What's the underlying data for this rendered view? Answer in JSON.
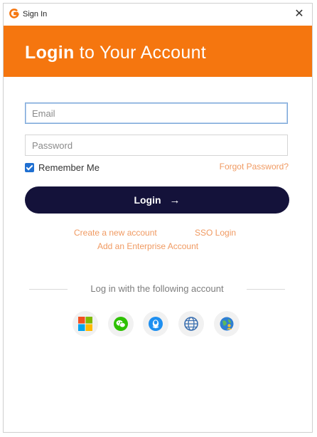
{
  "window": {
    "title": "Sign In",
    "close_glyph": "✕"
  },
  "banner": {
    "title_bold": "Login",
    "title_rest": " to Your Account",
    "color": "#f5760f"
  },
  "form": {
    "email_placeholder": "Email",
    "password_placeholder": "Password",
    "remember_label": "Remember Me",
    "remember_checked": true,
    "forgot_label": "Forgot Password?",
    "login_label": "Login",
    "login_arrow": "→"
  },
  "links": {
    "create_account": "Create a new account",
    "sso_login": "SSO Login",
    "add_enterprise": "Add an Enterprise Account"
  },
  "social": {
    "heading": "Log in with the following account",
    "providers": [
      "microsoft-icon",
      "wechat-icon",
      "qq-icon",
      "globe-icon",
      "globe-user-icon"
    ]
  },
  "colors": {
    "accent": "#f5760f",
    "button": "#14123a",
    "link": "#f09a62"
  }
}
